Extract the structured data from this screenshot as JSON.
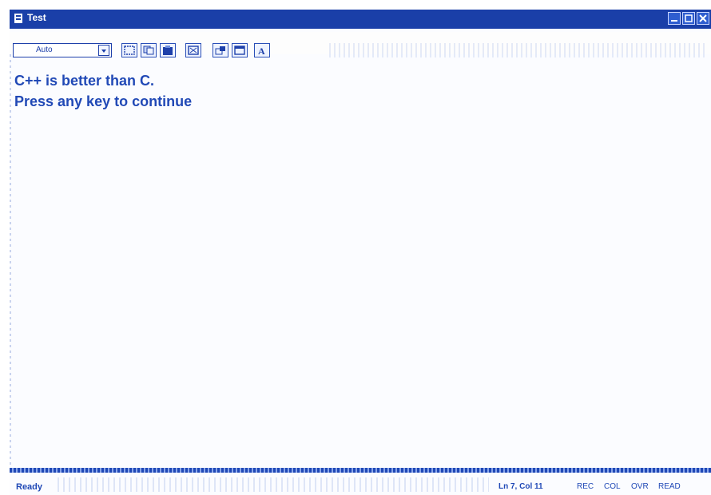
{
  "window": {
    "title": "Test",
    "accent": "#1a3fa8"
  },
  "toolbar": {
    "font_size_value": "Auto",
    "buttons": [
      {
        "icon": "mark-icon"
      },
      {
        "icon": "copy-icon"
      },
      {
        "icon": "paste-icon"
      },
      {
        "icon": "fullscreen-icon"
      },
      {
        "icon": "properties-icon"
      },
      {
        "icon": "background-icon"
      },
      {
        "icon": "font-icon",
        "glyph": "A"
      }
    ]
  },
  "console": {
    "lines": [
      "C++ is better than C.",
      "Press any key to continue"
    ],
    "text_color": "#2149b6"
  },
  "status": {
    "ready": "Ready",
    "position": "Ln 7, Col 11",
    "indicators": [
      "REC",
      "COL",
      "OVR",
      "READ"
    ]
  }
}
